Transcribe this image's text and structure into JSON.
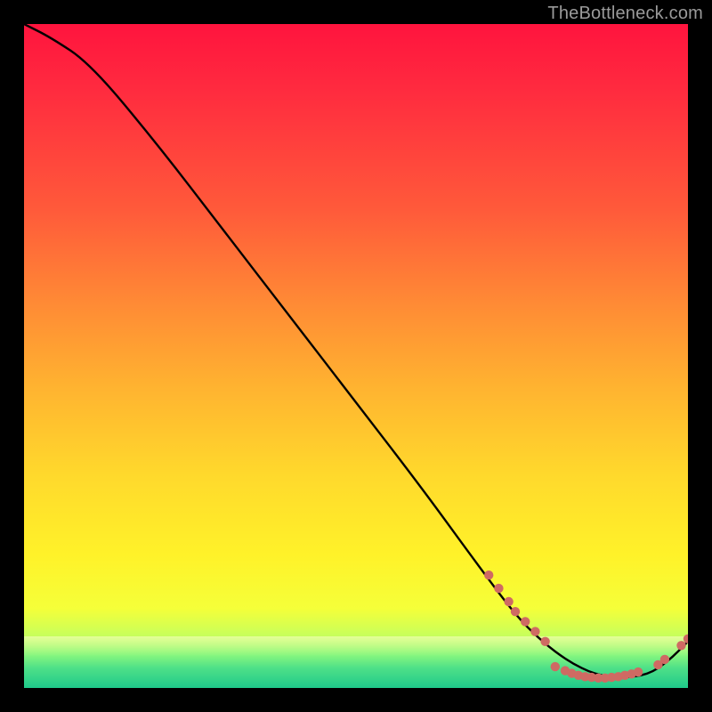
{
  "watermark": "TheBottleneck.com",
  "colors": {
    "frame_bg": "#000000",
    "curve": "#000000",
    "dots": "#cf6a63",
    "gradient_top": "#ff143e",
    "gradient_bottom": "#1fc98a"
  },
  "chart_data": {
    "type": "line",
    "title": "",
    "xlabel": "",
    "ylabel": "",
    "xlim": [
      0,
      100
    ],
    "ylim": [
      0,
      100
    ],
    "grid": false,
    "legend": false,
    "series": [
      {
        "name": "bottleneck-curve",
        "x": [
          0,
          4,
          10,
          20,
          30,
          40,
          50,
          60,
          68,
          74,
          78,
          82,
          86,
          90,
          94,
          97,
          100
        ],
        "y": [
          100,
          98,
          94,
          82,
          69,
          56,
          43,
          30,
          19,
          11,
          7,
          4,
          2,
          1.5,
          2,
          4,
          7
        ]
      }
    ],
    "dot_clusters": [
      {
        "name": "upper-cluster",
        "points": [
          {
            "x": 70,
            "y": 17
          },
          {
            "x": 71.5,
            "y": 15
          },
          {
            "x": 73,
            "y": 13
          },
          {
            "x": 74,
            "y": 11.5
          },
          {
            "x": 75.5,
            "y": 10
          },
          {
            "x": 77,
            "y": 8.5
          },
          {
            "x": 78.5,
            "y": 7
          }
        ]
      },
      {
        "name": "valley-cluster",
        "points": [
          {
            "x": 80,
            "y": 3.2
          },
          {
            "x": 81.5,
            "y": 2.6
          },
          {
            "x": 82.5,
            "y": 2.2
          },
          {
            "x": 83.5,
            "y": 1.9
          },
          {
            "x": 84.5,
            "y": 1.7
          },
          {
            "x": 85.5,
            "y": 1.6
          },
          {
            "x": 86.5,
            "y": 1.5
          },
          {
            "x": 87.5,
            "y": 1.5
          },
          {
            "x": 88.5,
            "y": 1.6
          },
          {
            "x": 89.5,
            "y": 1.7
          },
          {
            "x": 90.5,
            "y": 1.9
          },
          {
            "x": 91.5,
            "y": 2.1
          },
          {
            "x": 92.5,
            "y": 2.4
          }
        ]
      },
      {
        "name": "rising-cluster",
        "points": [
          {
            "x": 95.5,
            "y": 3.5
          },
          {
            "x": 96.5,
            "y": 4.3
          },
          {
            "x": 99,
            "y": 6.4
          },
          {
            "x": 100,
            "y": 7.4
          }
        ]
      }
    ]
  }
}
